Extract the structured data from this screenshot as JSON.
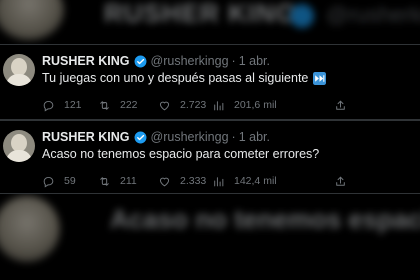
{
  "backdrop": {
    "top_name": "RUSHER KING",
    "top_handle": "@rusherkingg",
    "bottom_text": "Acaso no tenemos espacio"
  },
  "tweets": [
    {
      "name": "RUSHER KING",
      "handle": "@rusherkingg",
      "dot": "·",
      "date": "1 abr.",
      "text": "Tu juegas con uno y después pasas al siguiente",
      "emoji_icon": "fast-forward-emoji-icon",
      "replies": "121",
      "retweets": "222",
      "likes": "2.723",
      "views": "201,6 mil"
    },
    {
      "name": "RUSHER KING",
      "handle": "@rusherkingg",
      "dot": "·",
      "date": "1 abr.",
      "text": "Acaso no tenemos espacio para cometer errores?",
      "emoji_icon": "",
      "replies": "59",
      "retweets": "211",
      "likes": "2.333",
      "views": "142,4 mil"
    }
  ],
  "colors": {
    "background": "#000000",
    "text": "#e7e9ea",
    "muted": "#71767b",
    "verified": "#1d9bf0",
    "border": "#2f3336"
  }
}
